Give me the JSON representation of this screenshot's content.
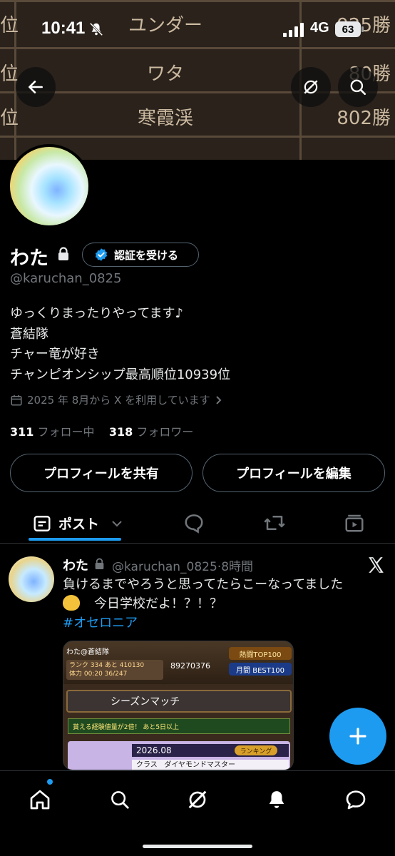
{
  "status_bar": {
    "time": "10:41",
    "network": "4G",
    "battery": "63"
  },
  "banner": {
    "rows": [
      {
        "rank": "位",
        "name": "ユンダー",
        "wins": "925勝"
      },
      {
        "rank": "位",
        "name": "ワタ",
        "wins": "80勝"
      },
      {
        "rank": "位",
        "name": "寒霞渓",
        "wins": "802勝"
      }
    ]
  },
  "header": {
    "back_icon": "arrow-left-icon",
    "grok_icon": "grok-icon",
    "search_icon": "search-icon"
  },
  "profile": {
    "name": "わた",
    "verify_button": "認証を受ける",
    "handle": "@karuchan_0825",
    "bio": [
      "ゆっくりまったりやってます♪",
      "蒼結隊",
      "チャー竜が好き",
      "チャンピオンシップ最高順位10939位"
    ],
    "joined": "2025 年 8月から X を利用しています",
    "following_count": "311",
    "following_label": "フォロー中",
    "followers_count": "318",
    "followers_label": "フォロワー",
    "share_button": "プロフィールを共有",
    "edit_button": "プロフィールを編集"
  },
  "tabs": {
    "posts_label": "ポスト"
  },
  "post": {
    "author": "わた",
    "handle": "@karuchan_0825",
    "dot": "·",
    "time": "8時間",
    "line1": "負けるまでやろうと思ってたらこーなってました",
    "line2": "今日学校だよ！？！？",
    "hashtag": "#オセロニア",
    "image": {
      "player": "わた@蒼結隊",
      "stats": "ランク 334 あと 410130",
      "stamina": "体力 00:20 36/247",
      "coins": "89270376",
      "top100": "熱闘TOP100",
      "best100": "月間 BEST100",
      "title": "シーズンマッチ",
      "banner": "貰える経験値量が2倍！ あと5日以上",
      "season": "2026.08",
      "ranking": "ランキング",
      "class_label": "クラス",
      "class_value": "ダイヤモンドマスター"
    }
  },
  "colors": {
    "accent": "#1d9bf0",
    "muted": "#71767b",
    "border": "#536471"
  }
}
